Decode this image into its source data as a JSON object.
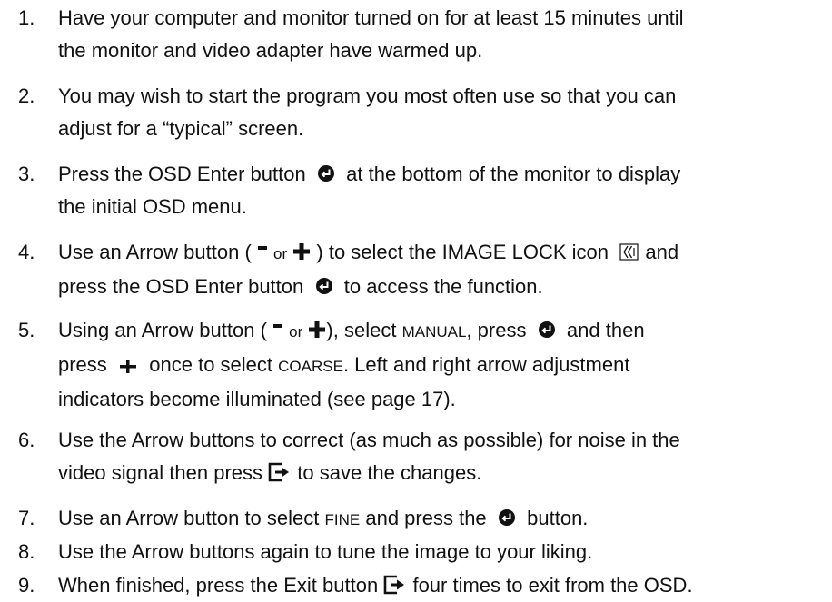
{
  "steps": [
    {
      "num": "1.",
      "lines": [
        "Have your computer and monitor turned on for at least 15 minutes until",
        "the monitor and video adapter have warmed up."
      ]
    },
    {
      "num": "2.",
      "lines": [
        "You may wish to start the program you most often use so that you can",
        "adjust for a “typical” screen."
      ]
    },
    {
      "num": "3.",
      "l1a": "Press the OSD Enter button",
      "l1b": "at the bottom of the monitor to display",
      "l2": "the initial OSD menu."
    },
    {
      "num": "4.",
      "l1a": "Use an Arrow button (",
      "l1or": "or",
      "l1b": ") to select the IMAGE LOCK icon",
      "l1c": "and",
      "l2a": "press the OSD Enter button",
      "l2b": "to access the function."
    },
    {
      "num": "5.",
      "l1a": "Using an Arrow button (",
      "l1or": "or",
      "l1b": "), select",
      "l1manual": "MANUAL",
      "l1c": ", press",
      "l1d": "and then",
      "l2a": "press",
      "l2b": "once to select",
      "l2coarse": "COARSE",
      "l2c": ". Left and right arrow adjustment",
      "l3": "indicators become illuminated (see page 17)."
    },
    {
      "num": "6.",
      "l1": "Use the Arrow buttons to correct (as much as possible) for noise in the",
      "l2a": "video signal then press",
      "l2b": "to save the changes."
    },
    {
      "num": "7.",
      "l1a": "Use an Arrow button to select",
      "l1fine": "FINE",
      "l1b": "and press the",
      "l1c": "button."
    },
    {
      "num": "8.",
      "l1": "Use the Arrow buttons again to tune the image to your liking."
    },
    {
      "num": "9.",
      "l1a": "When finished, press the Exit button",
      "l1b": "four times to exit from the OSD."
    }
  ],
  "icons": {
    "enter": "enter-button-icon",
    "minus": "minus-arrow-icon",
    "plus": "plus-arrow-icon",
    "image_lock": "image-lock-icon",
    "exit": "exit-button-icon"
  }
}
